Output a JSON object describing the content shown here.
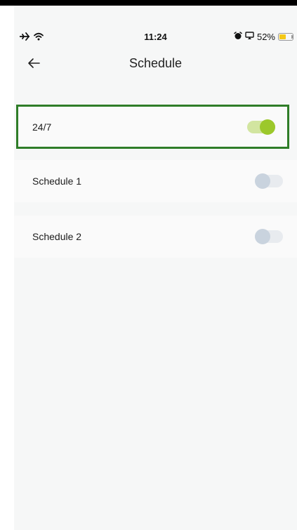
{
  "status_bar": {
    "time": "11:24",
    "battery_text": "52%",
    "battery_level": 0.52,
    "icons": [
      "airplane-icon",
      "wifi-icon",
      "alarm-icon",
      "screen-mirror-icon",
      "battery-icon"
    ]
  },
  "header": {
    "title": "Schedule",
    "back_icon": "back-arrow-icon"
  },
  "schedules": [
    {
      "label": "24/7",
      "enabled": true,
      "selected": true
    },
    {
      "label": "Schedule 1",
      "enabled": false,
      "selected": false
    },
    {
      "label": "Schedule 2",
      "enabled": false,
      "selected": false
    }
  ],
  "colors": {
    "selection_border": "#2f7d28",
    "toggle_on_knob": "#9cc82b",
    "toggle_on_track": "#d2e5a0",
    "toggle_off_knob": "#c9d3de",
    "toggle_off_track": "#e8ebef",
    "battery_fill": "#f4c817"
  }
}
